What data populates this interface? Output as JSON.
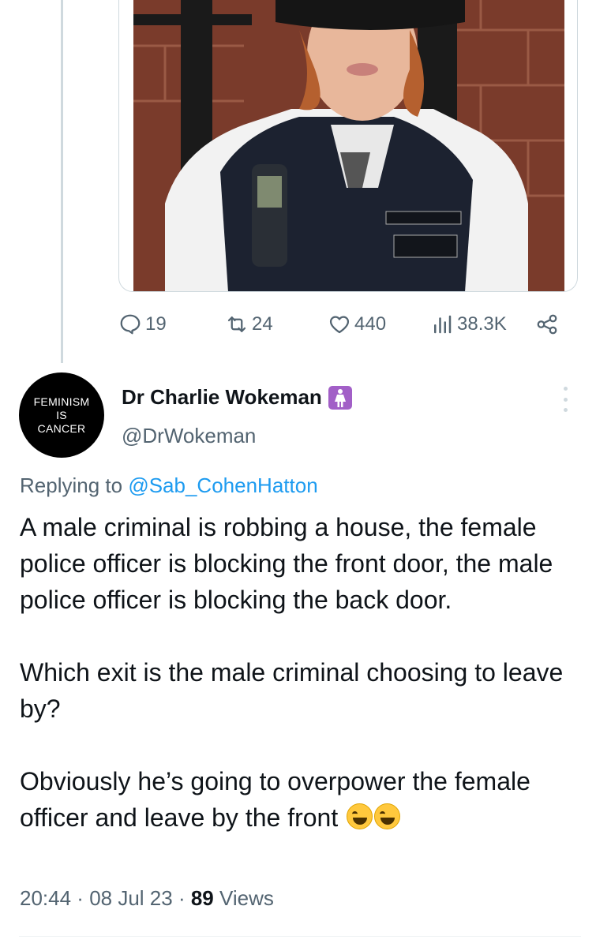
{
  "actions": {
    "replies": "19",
    "retweets": "24",
    "likes": "440",
    "views": "38.3K"
  },
  "author": {
    "avatar_lines": [
      "FEMINISM",
      "IS",
      "CANCER"
    ],
    "name": "Dr Charlie Wokeman",
    "handle": "@DrWokeman",
    "badge_icon": "woman-symbol-emoji"
  },
  "reply": {
    "prefix": "Replying to ",
    "mention": "@Sab_CohenHatton"
  },
  "tweet": {
    "paragraphs": [
      "A male criminal is robbing a house, the female police officer is blocking the front door, the male police officer is blocking the back door.",
      "Which exit is the male criminal choosing to leave by?",
      "Obviously he’s going to overpower the female officer and leave by the front"
    ],
    "emojis": [
      "face-with-tears-of-joy",
      "face-with-tears-of-joy"
    ]
  },
  "meta": {
    "time": "20:44",
    "sep1": " · ",
    "date": "08 Jul 23",
    "sep2": " · ",
    "views_count": "89",
    "views_label": " Views"
  },
  "colors": {
    "muted": "#536471",
    "link": "#1d9bf0",
    "text": "#0f1419",
    "border": "#cfd9de"
  }
}
